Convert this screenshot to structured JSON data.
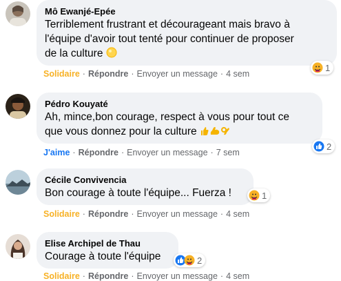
{
  "comments": [
    {
      "author": "Mô Ewanjé-Epée",
      "lines": [
        "Terriblement frustrant et décourageant mais bravo à",
        "l'équipe d'avoir tout tenté pour continuer de proposer",
        "de la culture"
      ],
      "trailing_emoji": "yellow-circle-emoji",
      "reaction_label": "Solidaire",
      "reaction_color": "#f7b125",
      "reply": "Répondre",
      "message": "Envoyer un message",
      "time": "4 sem",
      "reaction_count": "1",
      "reaction_icons": [
        "care-icon"
      ]
    },
    {
      "author": "Pédro Kouyaté",
      "lines": [
        "Ah, mince,bon courage, respect à vous pour tout ce",
        "que vous donnez pour la culture"
      ],
      "trailing_emoji": "thumbs-muscle-ok-emojis",
      "reaction_label": "J'aime",
      "reaction_color": "#1877f2",
      "reply": "Répondre",
      "message": "Envoyer un message",
      "time": "7 sem",
      "reaction_count": "2",
      "reaction_icons": [
        "like-icon"
      ]
    },
    {
      "author": "Cécile Convivencia",
      "lines": [
        "Bon courage à toute l'équipe... Fuerza !"
      ],
      "reaction_label": "Solidaire",
      "reaction_color": "#f7b125",
      "reply": "Répondre",
      "message": "Envoyer un message",
      "time": "4 sem",
      "reaction_count": "1",
      "reaction_icons": [
        "care-icon"
      ]
    },
    {
      "author": "Elise Archipel de Thau",
      "lines": [
        "Courage à toute l'équipe"
      ],
      "reaction_label": "Solidaire",
      "reaction_color": "#f7b125",
      "reply": "Répondre",
      "message": "Envoyer un message",
      "time": "4 sem",
      "reaction_count": "2",
      "reaction_icons": [
        "like-icon",
        "care-icon"
      ]
    }
  ],
  "separator": "·"
}
